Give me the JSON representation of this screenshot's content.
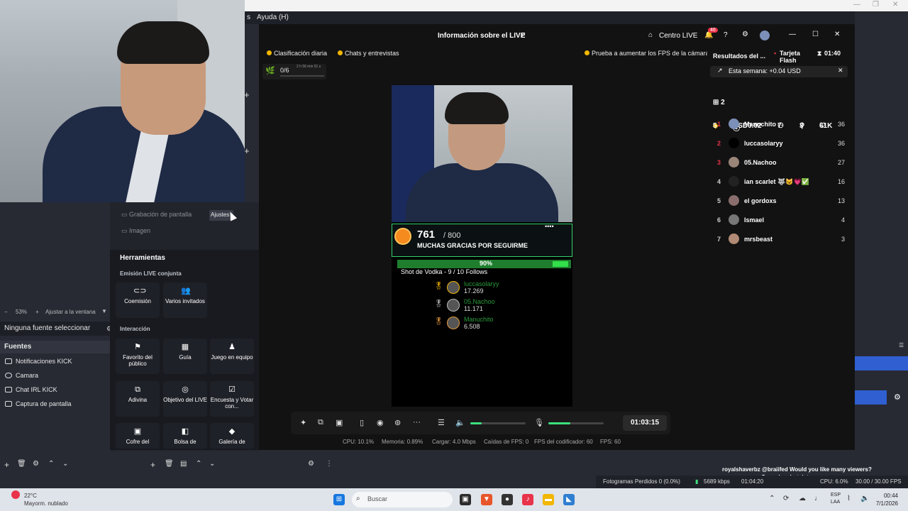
{
  "menu": {
    "help": "Ayuda (H)",
    "frag": "s"
  },
  "studio": {
    "title": "Información sobre el LIVE",
    "centro": "Centro LIVE",
    "notif_badge": "46",
    "pills": [
      "Clasificación diaria",
      "Chats y entrevistas"
    ],
    "fps_tip": "Prueba a aumentar los FPS de la cámara",
    "mini_progress": "0/6",
    "mini_time": "2 h 56 min 51 s"
  },
  "overlay": {
    "goal_current": "761",
    "goal_total": "/ 800",
    "goal_text": "MUCHAS GRACIAS POR SEGUIRME",
    "goal_dots": "••••",
    "follow_pct_value": 0.9,
    "follow_pct": "90%",
    "follow_text": "Shot de Vodka - 9 / 10 Follows",
    "leaders": [
      {
        "name": "luccasolaryy",
        "score": "17.269"
      },
      {
        "name": "05.Nachoo",
        "score": "11.171"
      },
      {
        "name": "Manuchito",
        "score": "6.508"
      }
    ]
  },
  "controls": {
    "timer": "01:03:15",
    "volume_level": 0.2,
    "mic_level": 0.4,
    "stats": {
      "cpu": "CPU: 10.1%",
      "mem": "Memoria: 0.89%",
      "load": "Cargar: 4.0 Mbps",
      "fps_drops": "Caídas de FPS: 0",
      "encoder": "FPS del codificador: 60",
      "fps": "FPS: 60"
    }
  },
  "results": {
    "title": "Resultados del ...",
    "flash": "Tarjeta Flash",
    "time": "01:40",
    "week": "Esta semana: +0.04 USD",
    "stats": [
      "5",
      "USD0.02",
      "7",
      "3",
      "61K"
    ],
    "gifts": "2",
    "ranking": [
      {
        "rank": "1",
        "user": "Manuchito",
        "value": "36"
      },
      {
        "rank": "2",
        "user": "luccasolaryy",
        "value": "36"
      },
      {
        "rank": "3",
        "user": "05.Nachoo",
        "value": "27"
      },
      {
        "rank": "4",
        "user": "ian scarlet 🐺😺💗✅",
        "value": "16"
      },
      {
        "rank": "5",
        "user": "el gordoxs",
        "value": "13"
      },
      {
        "rank": "6",
        "user": "Ismael",
        "value": "4"
      },
      {
        "rank": "7",
        "user": "mrsbeast",
        "value": "3"
      }
    ]
  },
  "obs": {
    "scenes": [
      "Grabación de pantalla",
      "Imagen"
    ],
    "tooltip": "Ajustes",
    "scale": "53%",
    "fit": "Ajustar a la ventana",
    "no_source": "Ninguna fuente seleccionar",
    "fuentes_title": "Fuentes",
    "sources": [
      "Notificaciones KICK",
      "Camara",
      "Chat IRL KICK",
      "Captura de pantalla"
    ]
  },
  "tools": {
    "title": "Herramientas",
    "sec1": "Emisión LIVE conjunta",
    "sec2": "Interacción",
    "items1": [
      "Coemisión",
      "Varios invitados"
    ],
    "items2": [
      "Favorito del público",
      "Guía",
      "Juego en equipo"
    ],
    "items3": [
      "Adivina",
      "Objetivo del LIVE",
      "Encuesta y Votar con..."
    ],
    "items4": [
      "Cofre del",
      "Bolsa de",
      "Galería de"
    ]
  },
  "chat": {
    "line1": "royalshaverbz  @braiifed Would you like many viewers?",
    "line2": "Come in – botsister.com"
  },
  "status": {
    "dropped": "Fotogramas Perdidos 0 (0.0%)",
    "kbps": "5689 kbps",
    "time": "01:04:20",
    "cpu": "CPU: 6.0%",
    "fps": "30.00 / 30.00 FPS"
  },
  "taskbar": {
    "temp": "22°C",
    "weather": "Mayorm. nublado",
    "search": "Buscar",
    "lang1": "ESP",
    "lang2": "LAA",
    "clock": "00:44",
    "date": "7/1/2026"
  },
  "colors": {
    "accent": "#33d16a",
    "obs_bg": "#272a33",
    "studio_bg": "#121212",
    "rank_red": "#e8334a"
  }
}
